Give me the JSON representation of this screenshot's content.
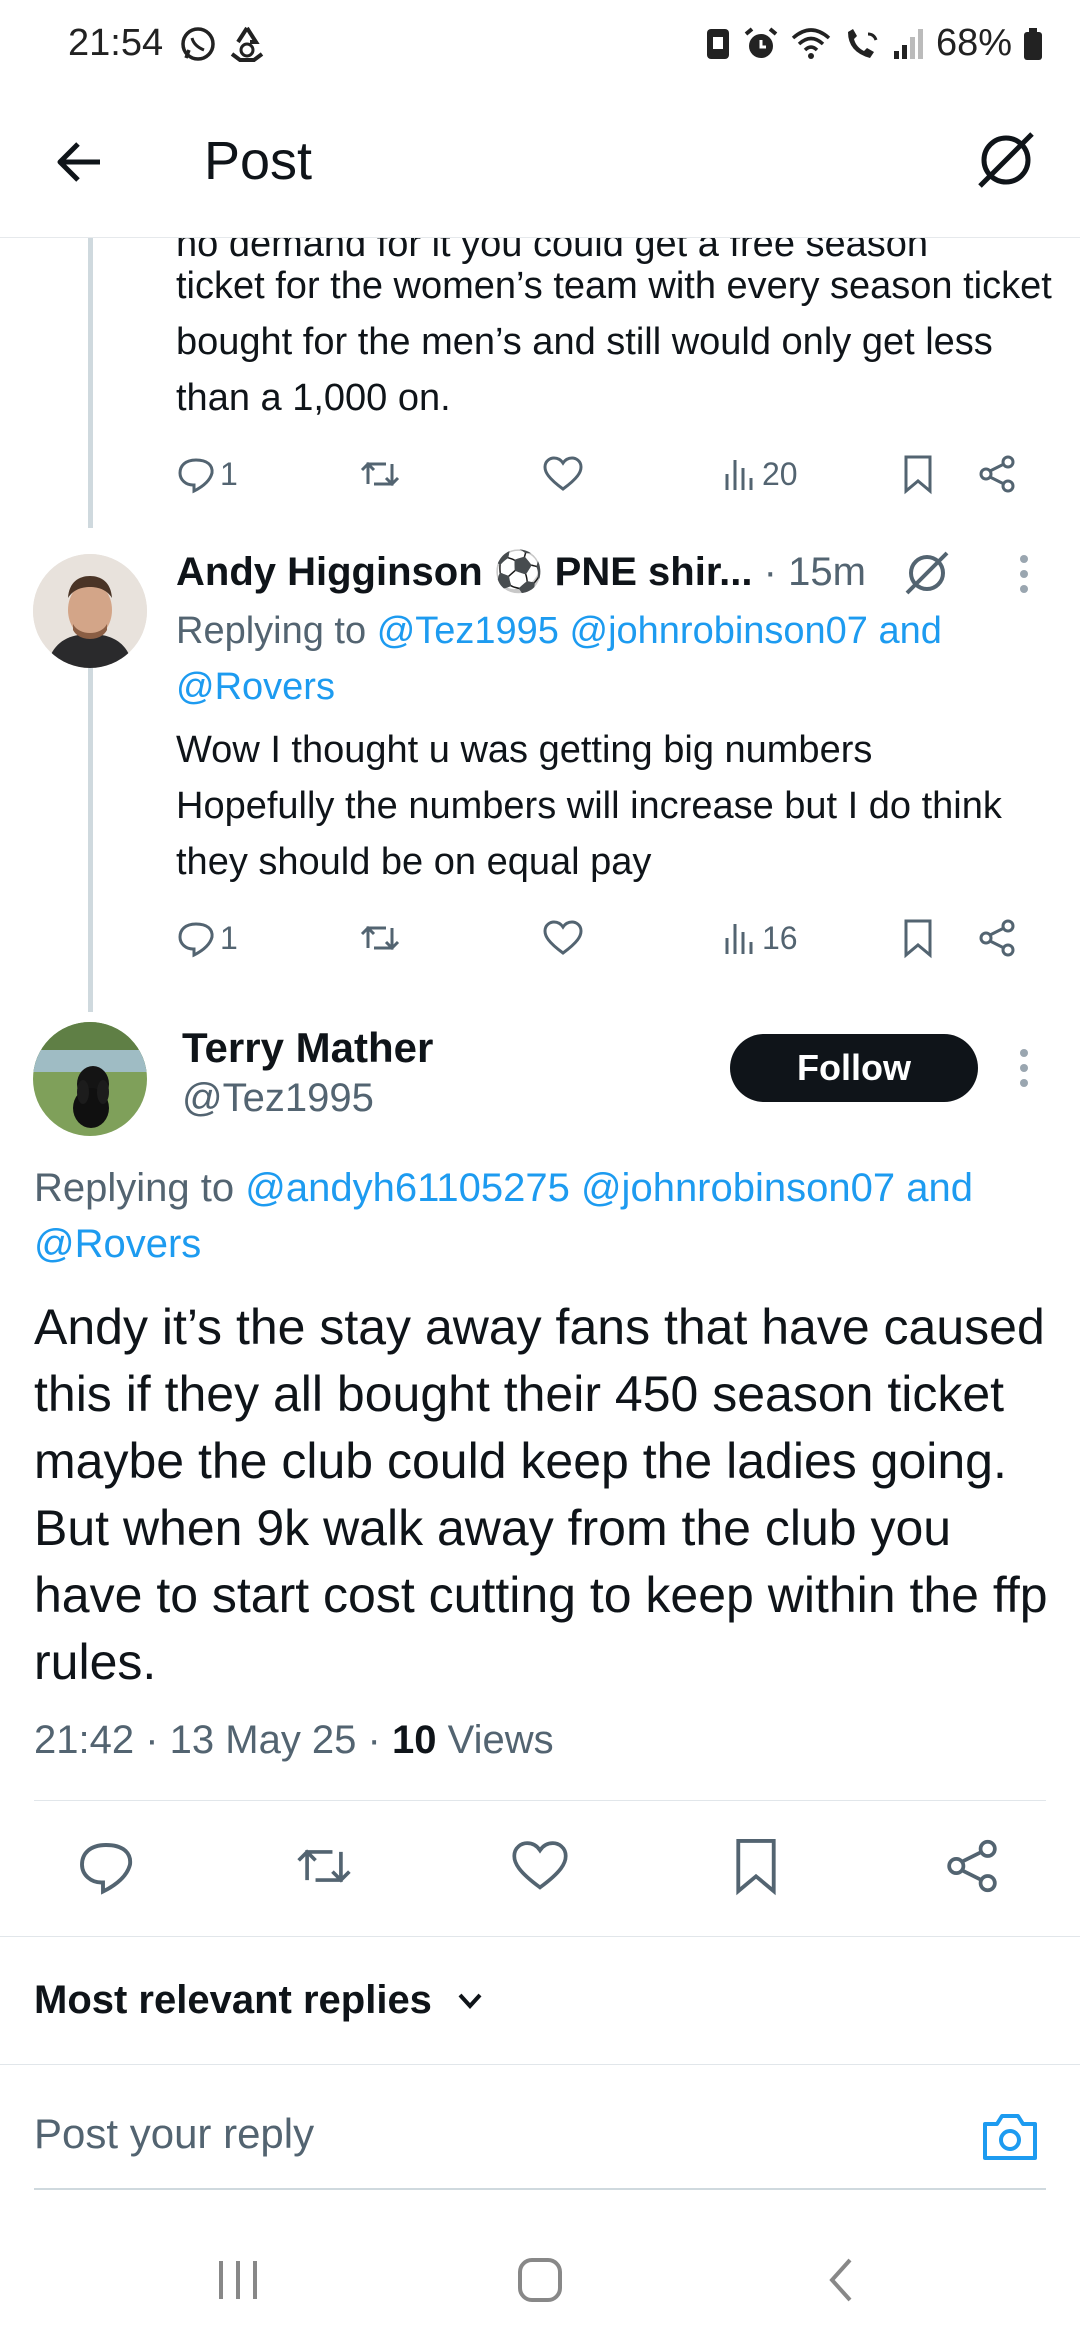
{
  "status_bar": {
    "time": "21:54",
    "battery": "68%",
    "icons": [
      "whatsapp-icon",
      "recycle-icon",
      "sim-icon",
      "alarm-icon",
      "wifi-icon",
      "wifi-call-icon",
      "signal-icon",
      "battery-icon"
    ]
  },
  "header": {
    "title": "Post",
    "back_icon": "arrow-left-icon",
    "grok_icon": "grok-icon"
  },
  "thread": [
    {
      "text_cut": "no demand for it you could get a free season",
      "text": "ticket for the women’s team with every season ticket bought for the men’s and still would only get less than a 1,000 on.",
      "replies": "1",
      "views": "20"
    },
    {
      "author": "Andy Higginson ⚽ PNE shir...",
      "time": "· 15m",
      "replying_label": "Replying to",
      "replying_links": "@Tez1995 @johnrobinson07 and @Rovers",
      "text": "Wow I thought u was getting big numbers Hopefully the numbers will increase but I do think they should be on equal pay",
      "replies": "1",
      "views": "16"
    }
  ],
  "main_post": {
    "author": "Terry Mather",
    "handle": "@Tez1995",
    "follow_label": "Follow",
    "replying_label": "Replying to",
    "replying_links": "@andyh61105275 @johnrobinson07 and @Rovers",
    "text": "Andy it’s the stay away fans that have caused this if they all bought their 450 season ticket maybe the club could keep the ladies going. But when 9k walk away from the club you have to start cost cutting to keep within the ffp rules.",
    "time": "21:42 · 13 May 25 ·",
    "views_count": "10",
    "views_label": "Views"
  },
  "sort_label": "Most relevant replies",
  "reply_placeholder": "Post your reply",
  "colors": {
    "link": "#1d9bf0",
    "muted": "#536471",
    "text": "#0f1419"
  }
}
